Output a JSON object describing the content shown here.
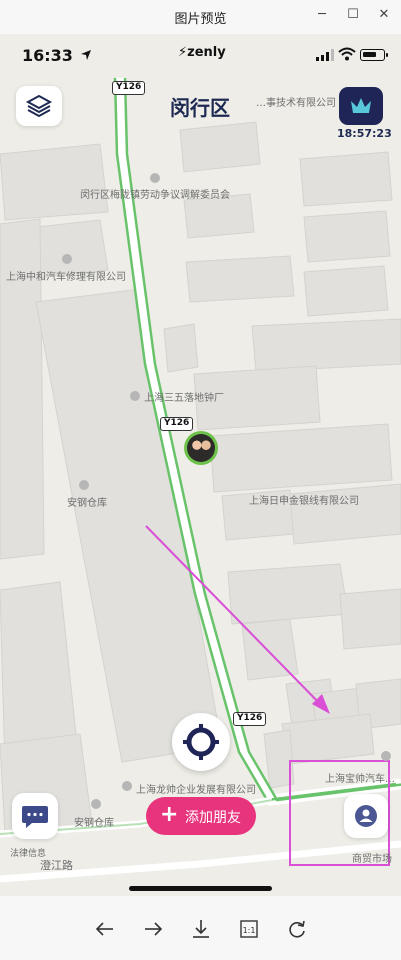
{
  "window": {
    "title": "图片预览",
    "minimize": "─",
    "maximize": "☐",
    "close": "✕"
  },
  "status": {
    "time": "16:33",
    "brand": "zenly"
  },
  "map": {
    "district": "闵行区",
    "clock": "18:57:23",
    "road_shields": [
      "Y126",
      "Y126",
      "Y126"
    ],
    "labels": {
      "tech": "…事技术有限公司",
      "committee": "闵行区梅陇镇劳动争议调解委员会",
      "auto_repair": "上海中和汽车修理有限公司",
      "clock_factory": "上海三五落地钟厂",
      "steel_wire": "上海日申金银线有限公司",
      "steel_warehouse": "安钢仓库",
      "baoshuai": "上海宝帅汽车…",
      "longshuai": "上海龙帅企业发展有限公司",
      "steel_warehouse_2": "安钢仓库",
      "rd": "法律信息",
      "road": "澄江路",
      "shop": "商贸市场"
    }
  },
  "buttons": {
    "add_friend": "添加朋友",
    "plus": "+"
  },
  "colors": {
    "road_green": "#69c36b",
    "accent_pink": "#e8347d",
    "navy": "#1f2657",
    "annotation": "#d94fd6"
  }
}
